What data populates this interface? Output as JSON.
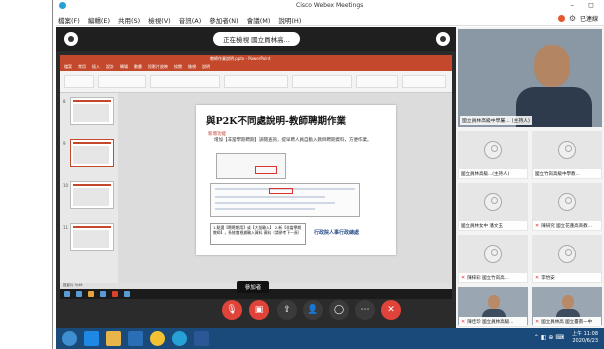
{
  "window": {
    "title": "Cisco Webex Meetings",
    "controls": "– ◻"
  },
  "menubar": {
    "items": [
      "檔案(F)",
      "編輯(E)",
      "共用(S)",
      "檢視(V)",
      "音訊(A)",
      "參加者(N)",
      "會議(M)",
      "說明(H)"
    ],
    "right_label": "已連線"
  },
  "sharing": {
    "label": "正在檢視 國立員林高..."
  },
  "ppt": {
    "window_title": "教師作業說明.pptx - PowerPoint",
    "tabs": [
      "檔案",
      "常用",
      "插入",
      "設計",
      "轉場",
      "動畫",
      "投影片放映",
      "校閱",
      "檢視",
      "說明"
    ],
    "status": "投影片 9/46",
    "thumb_numbers": [
      "8",
      "9",
      "10",
      "11"
    ]
  },
  "slide": {
    "title": "與P2K不同處說明-教師聘期作業",
    "bullet1": "新增功能",
    "bullet2": "增加【非當學期聘期】調閱查詢，提早聘人員自動入教師聘期資料，方便作業。",
    "note": "1.點選【聘聘期用】或【大批輸入】 2.新【非當學期教師】，系統會根據輸入資料 資料（請參考下一頁）",
    "logo": "行政院人事行政總處"
  },
  "tooltip": {
    "label": "參加者"
  },
  "participants": {
    "main": {
      "name": "國立員林高級中學屬...",
      "extra": "(主持人)"
    },
    "tiles": [
      {
        "name": "國立員林高級...(主持人)",
        "muted": false
      },
      {
        "name": "國立竹崗高級中學教...",
        "muted": false
      },
      {
        "name": "國立員林女中 潘文玉",
        "muted": false
      },
      {
        "name": "陳研究 國立花蓮高商教...",
        "muted": true
      },
      {
        "name": "陳梓彩 國立竹崗高...",
        "muted": true
      },
      {
        "name": "李怡安",
        "muted": true
      },
      {
        "name": "陳佳珍 國立員林高級...",
        "muted": true
      },
      {
        "name": "國立員林高 國立臺南一中",
        "muted": true
      }
    ]
  },
  "clock": {
    "time": "上午 11:08",
    "date": "2020/6/23"
  },
  "colors": {
    "webex_accent": "#27a0d6",
    "ppt_red": "#c4482b",
    "end_button": "#e0433a",
    "taskbar": "#1a4a7a"
  }
}
